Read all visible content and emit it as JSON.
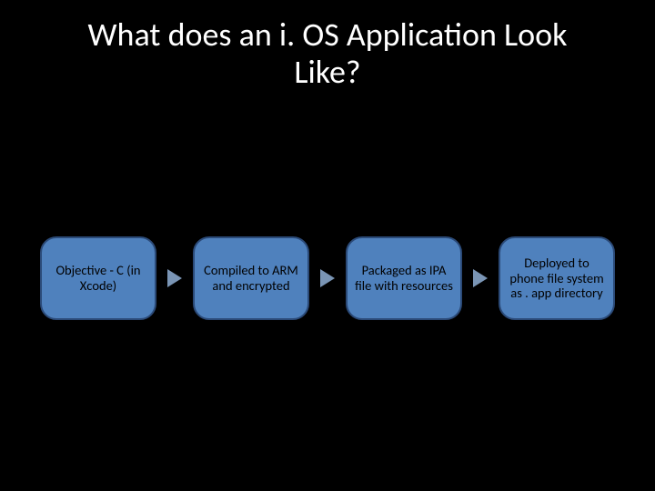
{
  "title": "What does an i. OS Application Look Like?",
  "flow": {
    "steps": [
      {
        "text": "Objective - C (in Xcode)"
      },
      {
        "text": "Compiled to ARM and encrypted"
      },
      {
        "text": "Packaged as IPA file with resources"
      },
      {
        "text": "Deployed to phone file system as . app directory"
      }
    ]
  }
}
